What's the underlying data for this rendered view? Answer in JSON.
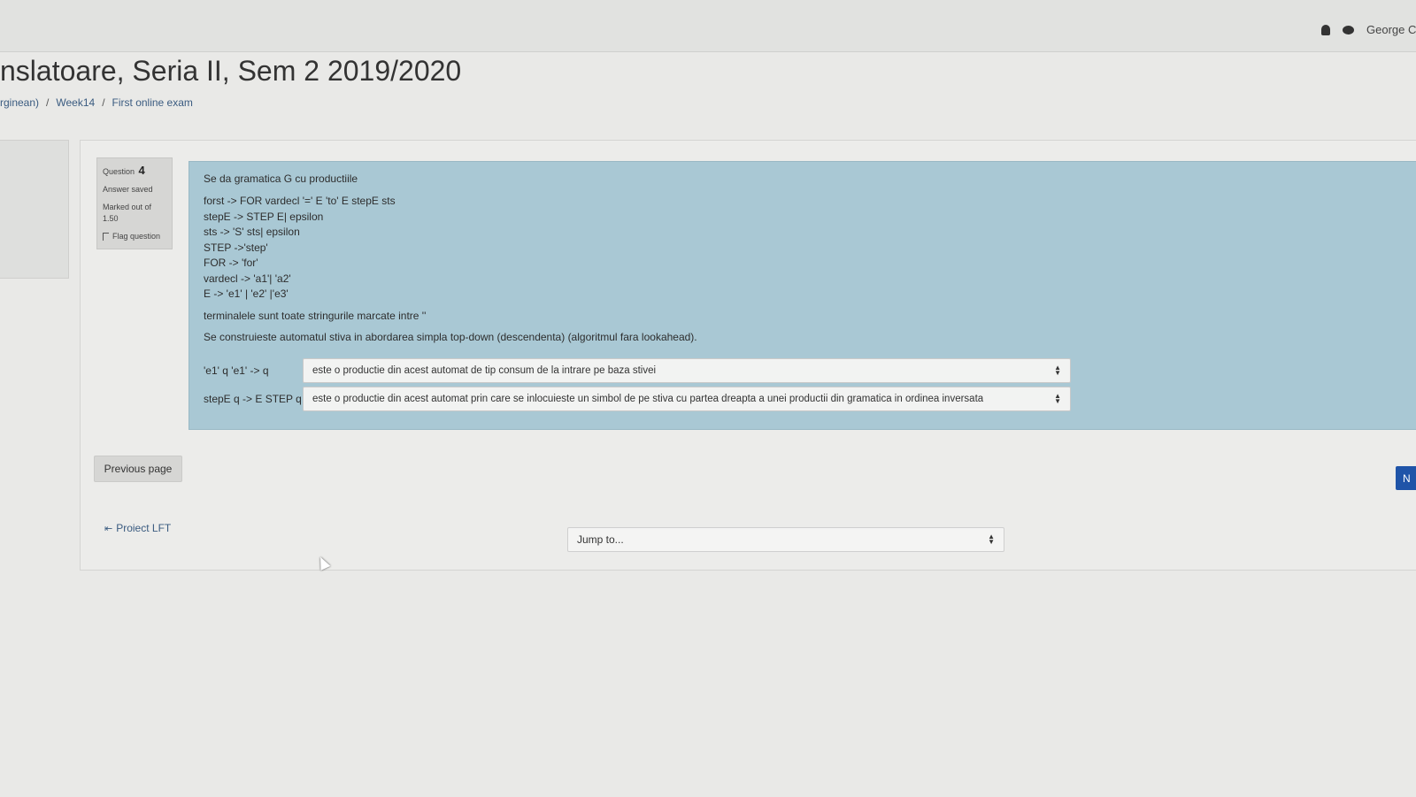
{
  "header": {
    "user_name": "George Cr",
    "icons": [
      "bell-icon",
      "chat-icon"
    ]
  },
  "page": {
    "title": "nslatoare, Seria II, Sem 2 2019/2020",
    "breadcrumb": [
      "rginean)",
      "Week14",
      "First online exam"
    ],
    "breadcrumb_separator": "/"
  },
  "question_info": {
    "label": "Question",
    "number": "4",
    "state": "Answer saved",
    "marked": "Marked out of 1.50",
    "flag_label": "Flag question"
  },
  "question": {
    "intro": "Se da gramatica G cu productiile",
    "grammar": [
      "forst -> FOR vardecl '=' E 'to' E stepE sts",
      "stepE -> STEP E| epsilon",
      "sts -> 'S' sts| epsilon",
      "STEP ->'step'",
      "FOR -> 'for'",
      "vardecl -> 'a1'| 'a2'",
      "E -> 'e1' | 'e2' |'e3'"
    ],
    "terminals_note": "terminalele sunt toate stringurile marcate intre ''",
    "automaton_note": "Se construieste automatul stiva in abordarea simpla top-down (descendenta) (algoritmul fara lookahead).",
    "answers": [
      {
        "label": "'e1' q 'e1' -> q",
        "selected": "este o productie din acest automat de tip consum de la intrare pe baza stivei"
      },
      {
        "label": "stepE q -> E STEP q",
        "selected": "este o productie din acest automat prin care se inlocuieste un simbol de pe stiva cu partea dreapta a unei productii din gramatica in ordinea inversata"
      }
    ]
  },
  "navigation": {
    "previous_page": "Previous page",
    "next_page": "N",
    "previous_activity": "Proiect LFT",
    "jump_placeholder": "Jump to..."
  }
}
